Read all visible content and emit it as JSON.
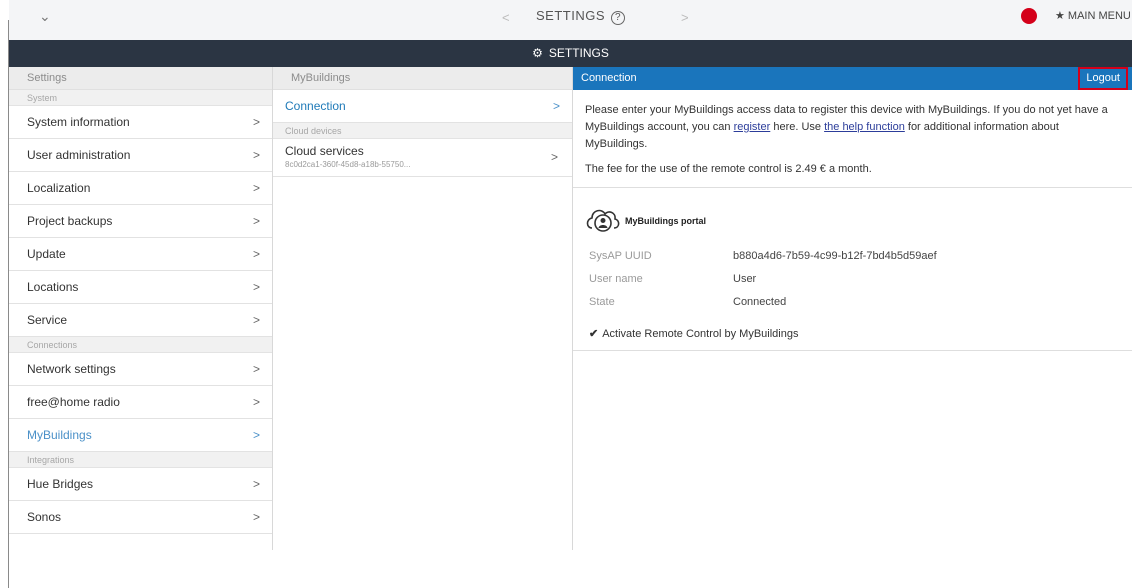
{
  "topbar": {
    "chevron": "⌄",
    "prev": "<",
    "next": ">",
    "title": "SETTINGS",
    "help": "?",
    "main_menu": "★ MAIN MENU"
  },
  "header": {
    "title": "SETTINGS"
  },
  "col1": {
    "heading": "Settings",
    "system_label": "System",
    "system_items": [
      "System information",
      "User administration",
      "Localization",
      "Project backups",
      "Update",
      "Locations",
      "Service"
    ],
    "connections_label": "Connections",
    "connections_items": [
      "Network settings",
      "free@home radio",
      "MyBuildings"
    ],
    "integrations_label": "Integrations",
    "integrations_items": [
      "Hue Bridges",
      "Sonos"
    ],
    "arrow": ">"
  },
  "col2": {
    "heading": "MyBuildings",
    "connection": "Connection",
    "cloud_label": "Cloud devices",
    "cloud_name": "Cloud services",
    "cloud_id": "8c0d2ca1-360f-45d8-a18b-55750...",
    "arrow": ">"
  },
  "col3": {
    "heading": "Connection",
    "logout": "Logout",
    "intro_1": "Please enter your MyBuildings access data to register this device with MyBuildings. If you do not yet have a MyBuildings account, you can ",
    "register_link": "register",
    "intro_2": " here. Use ",
    "help_link": "the help function",
    "intro_3": " for additional information about MyBuildings.",
    "fee": "The fee for the use of the remote control is 2.49 € a month.",
    "portal_label": "MyBuildings portal",
    "fields": [
      {
        "key": "SysAP UUID",
        "value": "b880a4d6-7b59-4c99-b12f-7bd4b5d59aef"
      },
      {
        "key": "User name",
        "value": "User"
      },
      {
        "key": "State",
        "value": "Connected"
      }
    ],
    "checkbox_mark": "✔",
    "checkbox_label": "Activate Remote Control by MyBuildings"
  },
  "colors": {
    "dark": "#2b3543",
    "blue": "#1a75bc",
    "accent": "#4a90c8",
    "alert": "#d4001a"
  }
}
